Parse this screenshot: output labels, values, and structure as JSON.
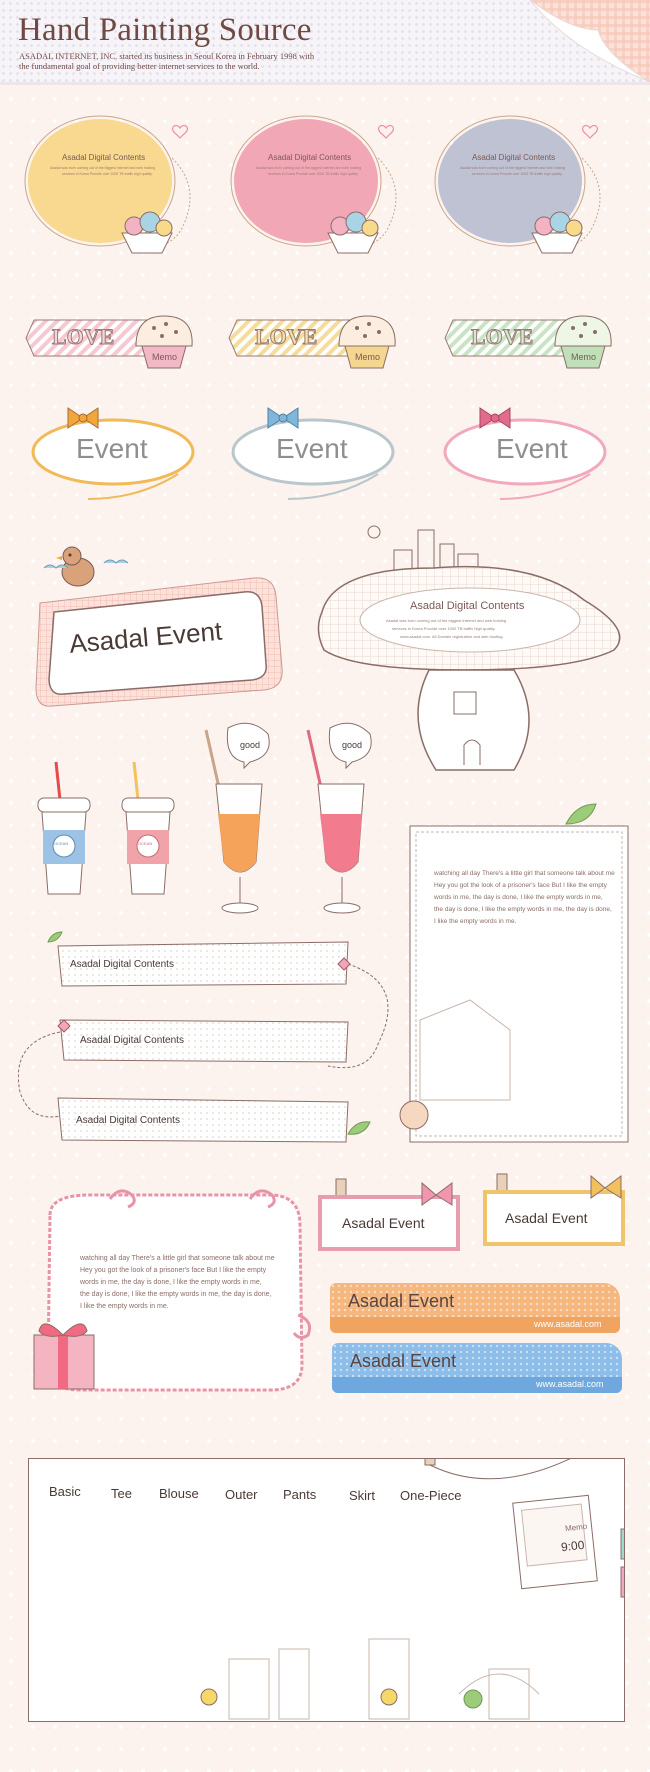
{
  "header": {
    "title": "Hand Painting Source",
    "subtitle": "ASADAL INTERNET, INC. started its business in Seoul Korea in February 1998 with the fundamental goal of providing better internet services to the world."
  },
  "bubbles": [
    {
      "title": "Asadal Digital Contents",
      "color": "#f8d98f",
      "lines": [
        "Asadal was born coming out of the biggest internet and web hosting",
        "services in Korea Provide over 1000 TB traffic high quality."
      ]
    },
    {
      "title": "Asadal Digital Contents",
      "color": "#f2a7b6",
      "lines": [
        "Asadal was born coming out of the biggest internet and web hosting",
        "services in Korea Provide over 1000 TB traffic high quality."
      ]
    },
    {
      "title": "Asadal Digital Contents",
      "color": "#bfc2d3",
      "lines": [
        "Asadal was born coming out of the biggest internet and web hosting",
        "services in Korea Provide over 1000 TB traffic high quality."
      ]
    }
  ],
  "love_tags": [
    {
      "love": "LOVE",
      "memo": "Memo",
      "stripe": "#f5c8d2",
      "muffin": "#f3b8c5"
    },
    {
      "love": "LOVE",
      "memo": "Memo",
      "stripe": "#f6dc9c",
      "muffin": "#f5d690"
    },
    {
      "love": "LOVE",
      "memo": "Memo",
      "stripe": "#c9e4c4",
      "muffin": "#bfe0b9"
    }
  ],
  "event_ovals": [
    {
      "label": "Event",
      "ring": "#f1b957",
      "bow": "#f3a73b"
    },
    {
      "label": "Event",
      "ring": "#b9c6cc",
      "bow": "#7fb7dc"
    },
    {
      "label": "Event",
      "ring": "#f2a8bd",
      "bow": "#e26a8b"
    }
  ],
  "asadal_event_board": {
    "label": "Asadal Event"
  },
  "mushroom": {
    "title": "Asadal Digital Contents",
    "lines": [
      "Asadal was born coming out of the biggest internet and web hosting",
      "services in Korea Provide over 1000 TB traffic high quality.",
      "www.asadal.com. All Domain registration and web hosting."
    ]
  },
  "drinks": [
    {
      "label": "OCEAN",
      "color": "#9cc3e6"
    },
    {
      "label": "OCEAN",
      "color": "#f0a3a8"
    }
  ],
  "glasses": [
    {
      "speech": "good",
      "color": "#f5a35b"
    },
    {
      "speech": "good",
      "color": "#f27b8e"
    }
  ],
  "note_frame": {
    "lines": [
      "watching all day There's a little girl that someone talk about me",
      "Hey you got the look of a prisoner's face But I like the empty",
      "words in me, the day is done, I like the empty words in me,",
      "the day is done, I like the empty words in me, the day is done,",
      "I like the empty words in me."
    ]
  },
  "tape_labels": [
    {
      "label": "Asadal Digital Contents"
    },
    {
      "label": "Asadal Digital Contents"
    },
    {
      "label": "Asadal Digital Contents"
    }
  ],
  "swirl_frame": {
    "lines": [
      "watching all day There's a little girl that someone talk about me",
      "Hey you got the look of a prisoner's face But I like the empty",
      "words in me, the day is done, I like the empty words in me,",
      "the day is done, I like the empty words in me, the day is done,",
      "I like the empty words in me."
    ]
  },
  "hanging_signs": [
    {
      "label": "Asadal Event",
      "border": "#e89cb0",
      "bow": "#f195b0"
    },
    {
      "label": "Asadal Event",
      "border": "#efc46a",
      "bow": "#f2c05c"
    }
  ],
  "dotted_banners": [
    {
      "label": "Asadal Event",
      "url": "www.asadal.com",
      "color": "#f6b77f"
    },
    {
      "label": "Asadal Event",
      "url": "www.asadal.com",
      "color": "#8dbde9"
    }
  ],
  "menu": {
    "items": [
      "Basic",
      "Tee",
      "Blouse",
      "Outer",
      "Pants",
      "Skirt",
      "One-Piece"
    ],
    "photo_note": "Memo",
    "photo_time": "9:00"
  }
}
